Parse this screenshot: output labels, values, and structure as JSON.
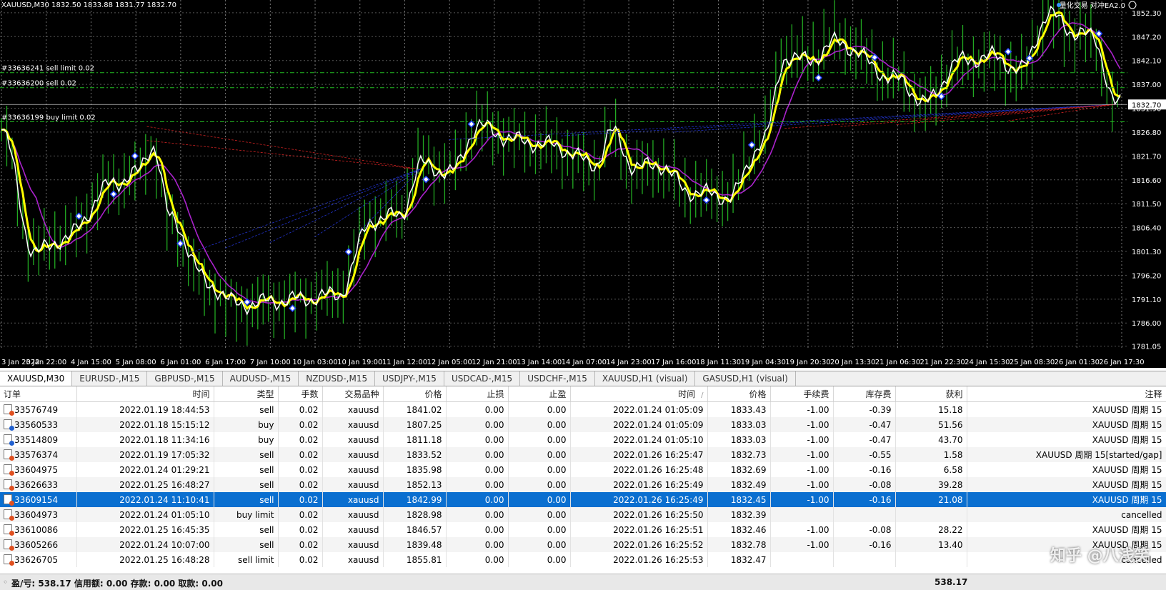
{
  "chart": {
    "symbol_info": "XAUUSD,M30  1832.50 1833.88 1831.77 1832.70",
    "ea_label": "量化交易 对冲EA2.0",
    "current_price": "1832.70",
    "price_ticks": [
      "1852.30",
      "1847.20",
      "1842.10",
      "1837.00",
      "1831.90",
      "1826.80",
      "1821.70",
      "1816.60",
      "1811.50",
      "1806.40",
      "1801.30",
      "1796.20",
      "1791.10",
      "1786.00",
      "1781.05"
    ],
    "time_ticks": [
      "3 Jan 2022",
      "3 Jan 22:00",
      "4 Jan 15:00",
      "5 Jan 08:00",
      "6 Jan 01:00",
      "6 Jan 17:00",
      "7 Jan 10:00",
      "10 Jan 03:00",
      "10 Jan 19:00",
      "11 Jan 12:00",
      "12 Jan 05:00",
      "12 Jan 21:00",
      "13 Jan 14:00",
      "14 Jan 07:00",
      "14 Jan 23:00",
      "17 Jan 16:00",
      "18 Jan 11:30",
      "19 Jan 04:30",
      "19 Jan 20:30",
      "20 Jan 13:30",
      "21 Jan 06:30",
      "21 Jan 22:30",
      "24 Jan 15:30",
      "25 Jan 08:30",
      "26 Jan 01:30",
      "26 Jan 17:30"
    ],
    "order_lines": [
      {
        "label": "#33636241 sell limit 0.02",
        "price": 1839.5
      },
      {
        "label": "#33636200 sell 0.02",
        "price": 1836.3
      },
      {
        "label": "#33636199 buy limit 0.02",
        "price": 1829.0
      }
    ],
    "colors": {
      "background": "#000000",
      "bars": "#22aa22",
      "fast_ma": "#ffff00",
      "mid_ma": "#ffffff",
      "slow_ma": "#aa22cc",
      "sell_line": "#cc2222",
      "buy_line": "#2233cc",
      "order_line": "#22bb22"
    }
  },
  "tabs": [
    "XAUUSD,M30",
    "EURUSD-,M15",
    "GBPUSD-,M15",
    "AUDUSD-,M15",
    "NZDUSD-,M15",
    "USDJPY-,M15",
    "USDCAD-,M15",
    "USDCHF-,M15",
    "XAUUSD,H1 (visual)",
    "GASUSD,H1 (visual)"
  ],
  "active_tab": 0,
  "history": {
    "columns": [
      "订单",
      "时间",
      "类型",
      "手数",
      "交易品种",
      "价格",
      "止损",
      "止盈",
      "时间",
      "价格",
      "手续费",
      "库存费",
      "获利",
      "注释"
    ],
    "sort_marker": "/",
    "selected_row": 6,
    "rows": [
      {
        "order": "33576749",
        "open_time": "2022.01.19 18:44:53",
        "type": "sell",
        "lots": "0.02",
        "symbol": "xauusd",
        "open_price": "1841.02",
        "sl": "0.00",
        "tp": "0.00",
        "close_time": "2022.01.24 01:05:09",
        "close_price": "1833.43",
        "commission": "-1.00",
        "swap": "-0.39",
        "profit": "15.18",
        "comment": "XAUUSD 周期 15",
        "icon_color": "#e05020"
      },
      {
        "order": "33560533",
        "open_time": "2022.01.18 15:15:12",
        "type": "buy",
        "lots": "0.02",
        "symbol": "xauusd",
        "open_price": "1807.25",
        "sl": "0.00",
        "tp": "0.00",
        "close_time": "2022.01.24 01:05:09",
        "close_price": "1833.03",
        "commission": "-1.00",
        "swap": "-0.47",
        "profit": "51.56",
        "comment": "XAUUSD 周期 15",
        "icon_color": "#2060d0"
      },
      {
        "order": "33514809",
        "open_time": "2022.01.18 11:34:16",
        "type": "buy",
        "lots": "0.02",
        "symbol": "xauusd",
        "open_price": "1811.18",
        "sl": "0.00",
        "tp": "0.00",
        "close_time": "2022.01.24 01:05:10",
        "close_price": "1833.03",
        "commission": "-1.00",
        "swap": "-0.47",
        "profit": "43.70",
        "comment": "XAUUSD 周期 15",
        "icon_color": "#2060d0"
      },
      {
        "order": "33576374",
        "open_time": "2022.01.19 17:05:32",
        "type": "sell",
        "lots": "0.02",
        "symbol": "xauusd",
        "open_price": "1833.52",
        "sl": "0.00",
        "tp": "0.00",
        "close_time": "2022.01.26 16:25:47",
        "close_price": "1832.73",
        "commission": "-1.00",
        "swap": "-0.55",
        "profit": "1.58",
        "comment": "XAUUSD 周期 15[started/gap]",
        "icon_color": "#e05020"
      },
      {
        "order": "33604975",
        "open_time": "2022.01.24 01:29:21",
        "type": "sell",
        "lots": "0.02",
        "symbol": "xauusd",
        "open_price": "1835.98",
        "sl": "0.00",
        "tp": "0.00",
        "close_time": "2022.01.26 16:25:48",
        "close_price": "1832.69",
        "commission": "-1.00",
        "swap": "-0.16",
        "profit": "6.58",
        "comment": "XAUUSD 周期 15",
        "icon_color": "#e05020"
      },
      {
        "order": "33626633",
        "open_time": "2022.01.25 16:48:27",
        "type": "sell",
        "lots": "0.02",
        "symbol": "xauusd",
        "open_price": "1852.13",
        "sl": "0.00",
        "tp": "0.00",
        "close_time": "2022.01.26 16:25:49",
        "close_price": "1832.49",
        "commission": "-1.00",
        "swap": "-0.08",
        "profit": "39.28",
        "comment": "XAUUSD 周期 15",
        "icon_color": "#e05020"
      },
      {
        "order": "33609154",
        "open_time": "2022.01.24 11:10:41",
        "type": "sell",
        "lots": "0.02",
        "symbol": "xauusd",
        "open_price": "1842.99",
        "sl": "0.00",
        "tp": "0.00",
        "close_time": "2022.01.26 16:25:49",
        "close_price": "1832.45",
        "commission": "-1.00",
        "swap": "-0.16",
        "profit": "21.08",
        "comment": "XAUUSD 周期 15",
        "icon_color": "#e05020"
      },
      {
        "order": "33604973",
        "open_time": "2022.01.24 01:05:10",
        "type": "buy limit",
        "lots": "0.02",
        "symbol": "xauusd",
        "open_price": "1828.98",
        "sl": "0.00",
        "tp": "0.00",
        "close_time": "2022.01.26 16:25:50",
        "close_price": "1832.39",
        "commission": "",
        "swap": "",
        "profit": "",
        "comment": "cancelled",
        "icon_color": "#e05020"
      },
      {
        "order": "33610086",
        "open_time": "2022.01.25 16:45:35",
        "type": "sell",
        "lots": "0.02",
        "symbol": "xauusd",
        "open_price": "1846.57",
        "sl": "0.00",
        "tp": "0.00",
        "close_time": "2022.01.26 16:25:51",
        "close_price": "1832.46",
        "commission": "-1.00",
        "swap": "-0.08",
        "profit": "28.22",
        "comment": "XAUUSD 周期 15",
        "icon_color": "#e05020"
      },
      {
        "order": "33605266",
        "open_time": "2022.01.24 10:07:00",
        "type": "sell",
        "lots": "0.02",
        "symbol": "xauusd",
        "open_price": "1839.48",
        "sl": "0.00",
        "tp": "0.00",
        "close_time": "2022.01.26 16:25:52",
        "close_price": "1832.78",
        "commission": "-1.00",
        "swap": "-0.16",
        "profit": "13.40",
        "comment": "XAUUSD 周期 15",
        "icon_color": "#e05020"
      },
      {
        "order": "33626705",
        "open_time": "2022.01.25 16:48:28",
        "type": "sell limit",
        "lots": "0.02",
        "symbol": "xauusd",
        "open_price": "1855.81",
        "sl": "0.00",
        "tp": "0.00",
        "close_time": "2022.01.26 16:25:53",
        "close_price": "1832.47",
        "commission": "",
        "swap": "",
        "profit": "",
        "comment": "cancelled",
        "icon_color": "#e05020"
      }
    ]
  },
  "status": {
    "summary": "盈/亏: 538.17  信用额: 0.00  存款: 0.00  取款: 0.00",
    "total_profit": "538.17"
  },
  "watermark": "知乎 @八浅笑"
}
